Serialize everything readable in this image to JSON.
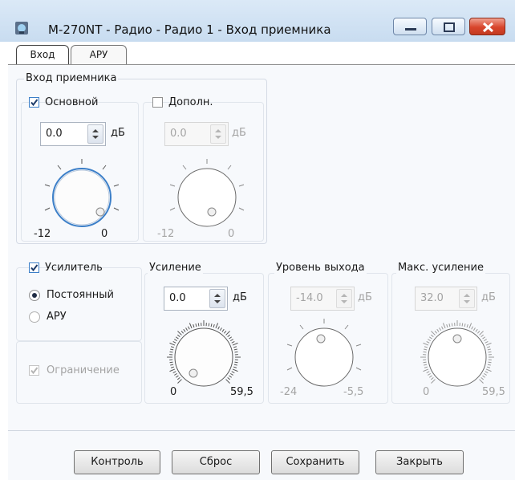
{
  "window": {
    "title": "M-270NT - Радио - Радио 1 - Вход приемника"
  },
  "tabs": [
    {
      "label": "Вход",
      "active": true
    },
    {
      "label": "АРУ",
      "active": false
    }
  ],
  "receiver_input": {
    "group_label": "Вход приемника",
    "main": {
      "label": "Основной",
      "checked": true,
      "value": "0.0",
      "unit": "дБ",
      "scale_min": "-12",
      "scale_max": "0"
    },
    "extra": {
      "label": "Дополн.",
      "checked": false,
      "enabled": false,
      "value": "0.0",
      "unit": "дБ",
      "scale_min": "-12",
      "scale_max": "0"
    }
  },
  "amplifier": {
    "label": "Усилитель",
    "checked": true,
    "mode_constant": "Постоянный",
    "mode_agc": "АРУ",
    "selected_mode": "Постоянный",
    "limit": {
      "label": "Ограничение",
      "checked": true,
      "enabled": false
    }
  },
  "gain": {
    "label": "Усиление",
    "value": "0.0",
    "unit": "дБ",
    "scale_min": "0",
    "scale_max": "59,5"
  },
  "output_level": {
    "label": "Уровень выхода",
    "value": "-14.0",
    "unit": "дБ",
    "scale_min": "-24",
    "scale_max": "-5,5",
    "enabled": false
  },
  "max_gain": {
    "label": "Макс. усиление",
    "value": "32.0",
    "unit": "дБ",
    "scale_min": "0",
    "scale_max": "59,5",
    "enabled": false
  },
  "buttons": {
    "control": "Контроль",
    "reset": "Сброс",
    "save": "Сохранить",
    "close": "Закрыть"
  },
  "colors": {
    "accent": "#3c7fc8",
    "close_button": "#d8452c",
    "disabled_text": "#a4a4a4"
  }
}
